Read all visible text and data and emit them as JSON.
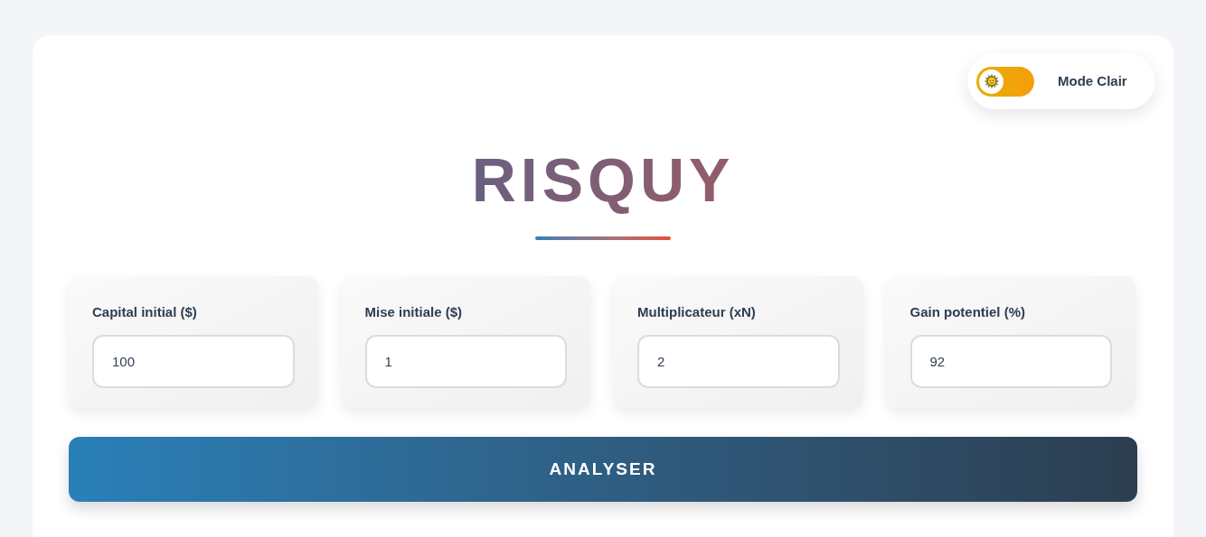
{
  "theme_toggle": {
    "on": false,
    "label": "Mode Clair"
  },
  "title": "RISQUY",
  "fields": [
    {
      "label": "Capital initial ($)",
      "value": "100"
    },
    {
      "label": "Mise initiale ($)",
      "value": "1"
    },
    {
      "label": "Multiplicateur (xN)",
      "value": "2"
    },
    {
      "label": "Gain potentiel (%)",
      "value": "92"
    }
  ],
  "button": "ANALYSER"
}
